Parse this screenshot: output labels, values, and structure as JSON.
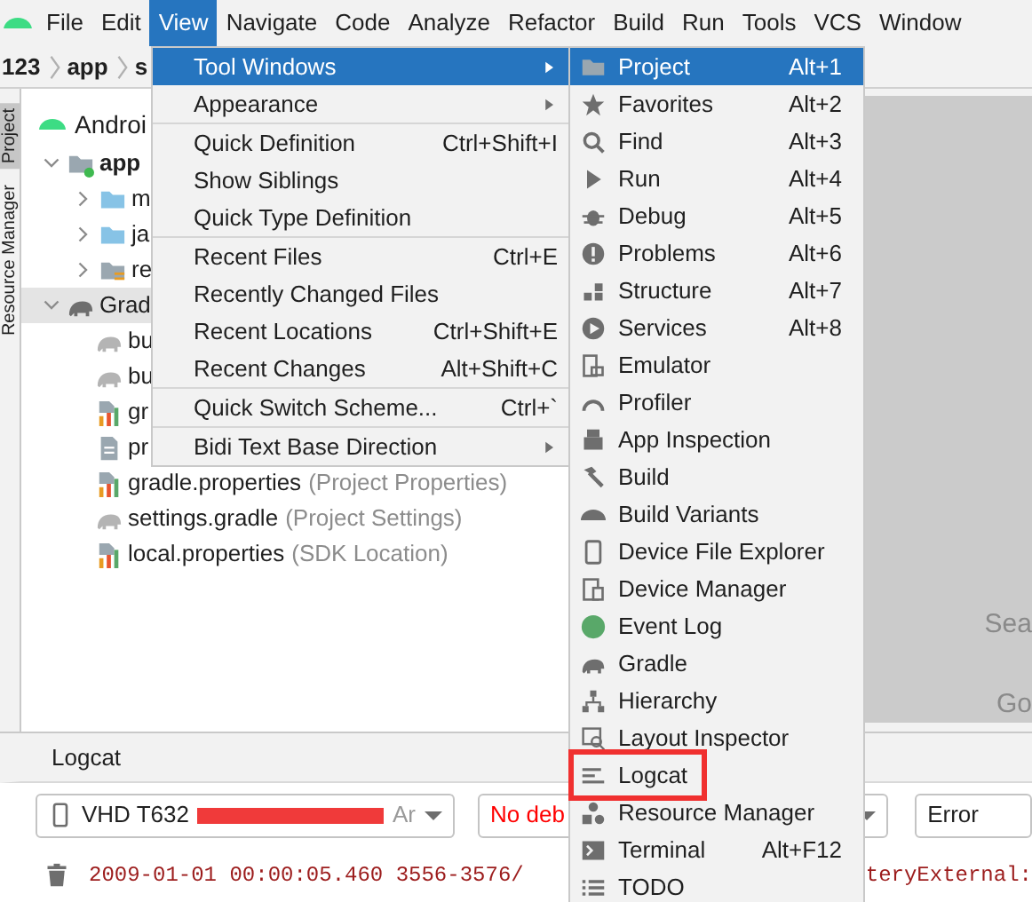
{
  "menubar": {
    "items": [
      {
        "label": "File",
        "selected": false
      },
      {
        "label": "Edit",
        "selected": false
      },
      {
        "label": "View",
        "selected": true
      },
      {
        "label": "Navigate",
        "selected": false
      },
      {
        "label": "Code",
        "selected": false
      },
      {
        "label": "Analyze",
        "selected": false
      },
      {
        "label": "Refactor",
        "selected": false
      },
      {
        "label": "Build",
        "selected": false
      },
      {
        "label": "Run",
        "selected": false
      },
      {
        "label": "Tools",
        "selected": false
      },
      {
        "label": "VCS",
        "selected": false
      },
      {
        "label": "Window",
        "selected": false
      }
    ]
  },
  "breadcrumb": [
    "123",
    "app",
    "s"
  ],
  "side_tabs": [
    {
      "label": "Project",
      "selected": true
    },
    {
      "label": "Resource Manager",
      "selected": false
    }
  ],
  "project_panel": {
    "view": "Androi",
    "tree": [
      {
        "kind": "module",
        "label": "app",
        "bold": true,
        "expanded": true,
        "selected": false,
        "children": [
          {
            "kind": "folder",
            "label": "m",
            "expanded": false,
            "selected": false
          },
          {
            "kind": "folder",
            "label": "ja",
            "expanded": false,
            "selected": false
          },
          {
            "kind": "res",
            "label": "re",
            "expanded": false,
            "selected": false
          }
        ]
      },
      {
        "kind": "gradle",
        "label": "Grad",
        "expanded": true,
        "selected": true,
        "children": [
          {
            "kind": "elephant",
            "label": "bu",
            "selected": false
          },
          {
            "kind": "elephant",
            "label": "bu",
            "selected": false
          },
          {
            "kind": "properties",
            "label": "gr",
            "selected": false
          },
          {
            "kind": "doc",
            "label": "pr",
            "selected": false
          },
          {
            "kind": "properties",
            "label": "gradle.properties",
            "note": "(Project Properties)",
            "selected": false
          },
          {
            "kind": "elephant",
            "label": "settings.gradle",
            "note": "(Project Settings)",
            "selected": false
          },
          {
            "kind": "properties",
            "label": "local.properties",
            "note": "(SDK Location)",
            "selected": false
          }
        ]
      }
    ]
  },
  "view_menu": {
    "items": [
      {
        "kind": "submenu",
        "label": "Tool Windows",
        "selected": true
      },
      {
        "kind": "submenu",
        "label": "Appearance",
        "selected": false
      },
      {
        "kind": "separator"
      },
      {
        "kind": "item",
        "label": "Quick Definition",
        "shortcut": "Ctrl+Shift+I",
        "selected": false
      },
      {
        "kind": "item",
        "label": "Show Siblings",
        "selected": false
      },
      {
        "kind": "item",
        "label": "Quick Type Definition",
        "selected": false
      },
      {
        "kind": "separator"
      },
      {
        "kind": "item",
        "label": "Recent Files",
        "shortcut": "Ctrl+E",
        "selected": false
      },
      {
        "kind": "item",
        "label": "Recently Changed Files",
        "selected": false
      },
      {
        "kind": "item",
        "label": "Recent Locations",
        "shortcut": "Ctrl+Shift+E",
        "selected": false
      },
      {
        "kind": "item",
        "label": "Recent Changes",
        "shortcut": "Alt+Shift+C",
        "selected": false
      },
      {
        "kind": "separator"
      },
      {
        "kind": "item",
        "label": "Quick Switch Scheme...",
        "shortcut": "Ctrl+`",
        "selected": false
      },
      {
        "kind": "separator"
      },
      {
        "kind": "submenu",
        "label": "Bidi Text Base Direction",
        "selected": false
      }
    ]
  },
  "tool_windows_menu": {
    "items": [
      {
        "kind": "folder",
        "label": "Project",
        "shortcut": "Alt+1",
        "selected": true
      },
      {
        "kind": "star",
        "label": "Favorites",
        "shortcut": "Alt+2",
        "selected": false
      },
      {
        "kind": "search",
        "label": "Find",
        "shortcut": "Alt+3",
        "selected": false
      },
      {
        "kind": "play",
        "label": "Run",
        "shortcut": "Alt+4",
        "selected": false
      },
      {
        "kind": "bug",
        "label": "Debug",
        "shortcut": "Alt+5",
        "selected": false
      },
      {
        "kind": "alert",
        "label": "Problems",
        "shortcut": "Alt+6",
        "selected": false
      },
      {
        "kind": "blocks",
        "label": "Structure",
        "shortcut": "Alt+7",
        "selected": false
      },
      {
        "kind": "services",
        "label": "Services",
        "shortcut": "Alt+8",
        "selected": false
      },
      {
        "kind": "emulator",
        "label": "Emulator",
        "selected": false
      },
      {
        "kind": "gauge",
        "label": "Profiler",
        "selected": false
      },
      {
        "kind": "chip",
        "label": "App Inspection",
        "selected": false
      },
      {
        "kind": "hammer",
        "label": "Build",
        "selected": false
      },
      {
        "kind": "android",
        "label": "Build Variants",
        "selected": false
      },
      {
        "kind": "phone",
        "label": "Device File Explorer",
        "selected": false
      },
      {
        "kind": "devices",
        "label": "Device Manager",
        "selected": false
      },
      {
        "kind": "dot",
        "label": "Event Log",
        "selected": false
      },
      {
        "kind": "elephant",
        "label": "Gradle",
        "selected": false
      },
      {
        "kind": "hierarchy",
        "label": "Hierarchy",
        "selected": false
      },
      {
        "kind": "layout",
        "label": "Layout Inspector",
        "selected": false
      },
      {
        "kind": "lines",
        "label": "Logcat",
        "selected": false,
        "highlighted": true
      },
      {
        "kind": "shapes",
        "label": "Resource Manager",
        "selected": false
      },
      {
        "kind": "terminal",
        "label": "Terminal",
        "shortcut": "Alt+F12",
        "selected": false
      },
      {
        "kind": "list",
        "label": "TODO",
        "selected": false
      }
    ]
  },
  "editor": {
    "hints": [
      "Sea",
      "Go"
    ]
  },
  "logcat": {
    "title": "Logcat",
    "device": "VHD T632",
    "device_tail": "Ar",
    "debug_filter": "No deb",
    "level_filter": "Error",
    "log_line": "2009-01-01 00:00:05.460 3556-3576/",
    "log_line_tail": "teryExternal:"
  }
}
